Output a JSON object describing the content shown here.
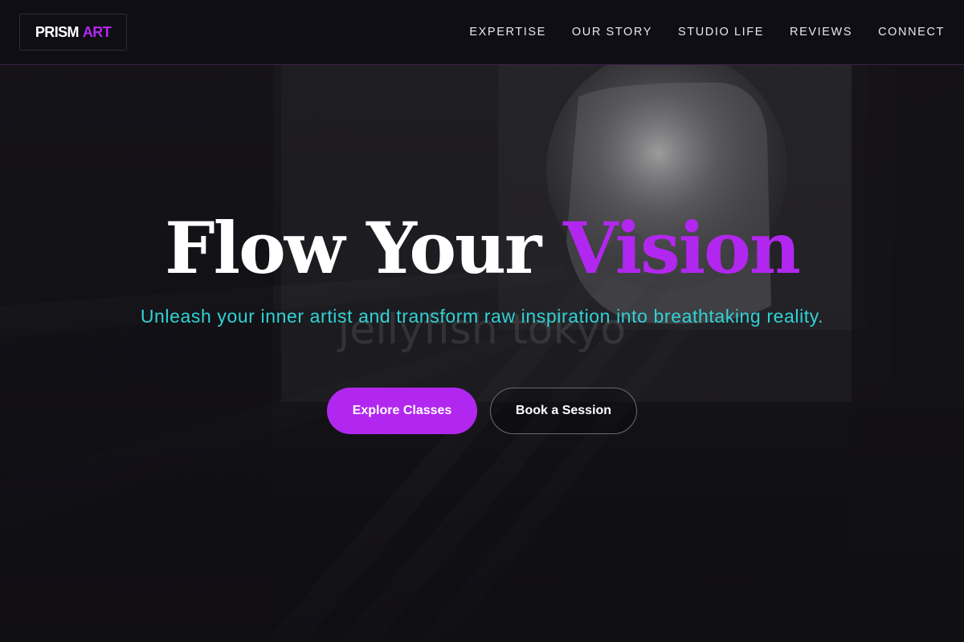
{
  "header": {
    "logo": {
      "word": "PRISM",
      "accent": "ART"
    },
    "nav": [
      {
        "label": "EXPERTISE"
      },
      {
        "label": "OUR STORY"
      },
      {
        "label": "STUDIO LIFE"
      },
      {
        "label": "REVIEWS"
      },
      {
        "label": "CONNECT"
      }
    ]
  },
  "hero": {
    "title_main": "Flow Your",
    "title_accent": "Vision",
    "subtitle": "Unleash your inner artist and transform raw inspiration into breathtaking reality.",
    "watermark": "jellyfish tokyo",
    "primary_cta": "Explore Classes",
    "secondary_cta": "Book a Session"
  },
  "colors": {
    "accent": "#b227ef",
    "subtitle": "#2fd3d6",
    "background": "#0f0e13",
    "text": "#ffffff"
  }
}
